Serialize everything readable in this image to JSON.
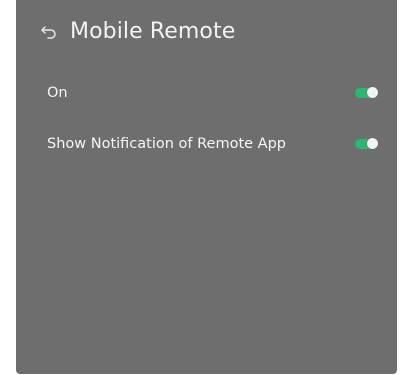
{
  "header": {
    "back_icon": "back-arrow-icon",
    "title": "Mobile Remote"
  },
  "settings": [
    {
      "label": "On",
      "toggle_state": "on"
    },
    {
      "label": "Show Notification of Remote App",
      "toggle_state": "on"
    }
  ],
  "colors": {
    "panel_background": "#6e6e6e",
    "toggle_on": "#2bb673",
    "text": "#f5f5f5"
  }
}
